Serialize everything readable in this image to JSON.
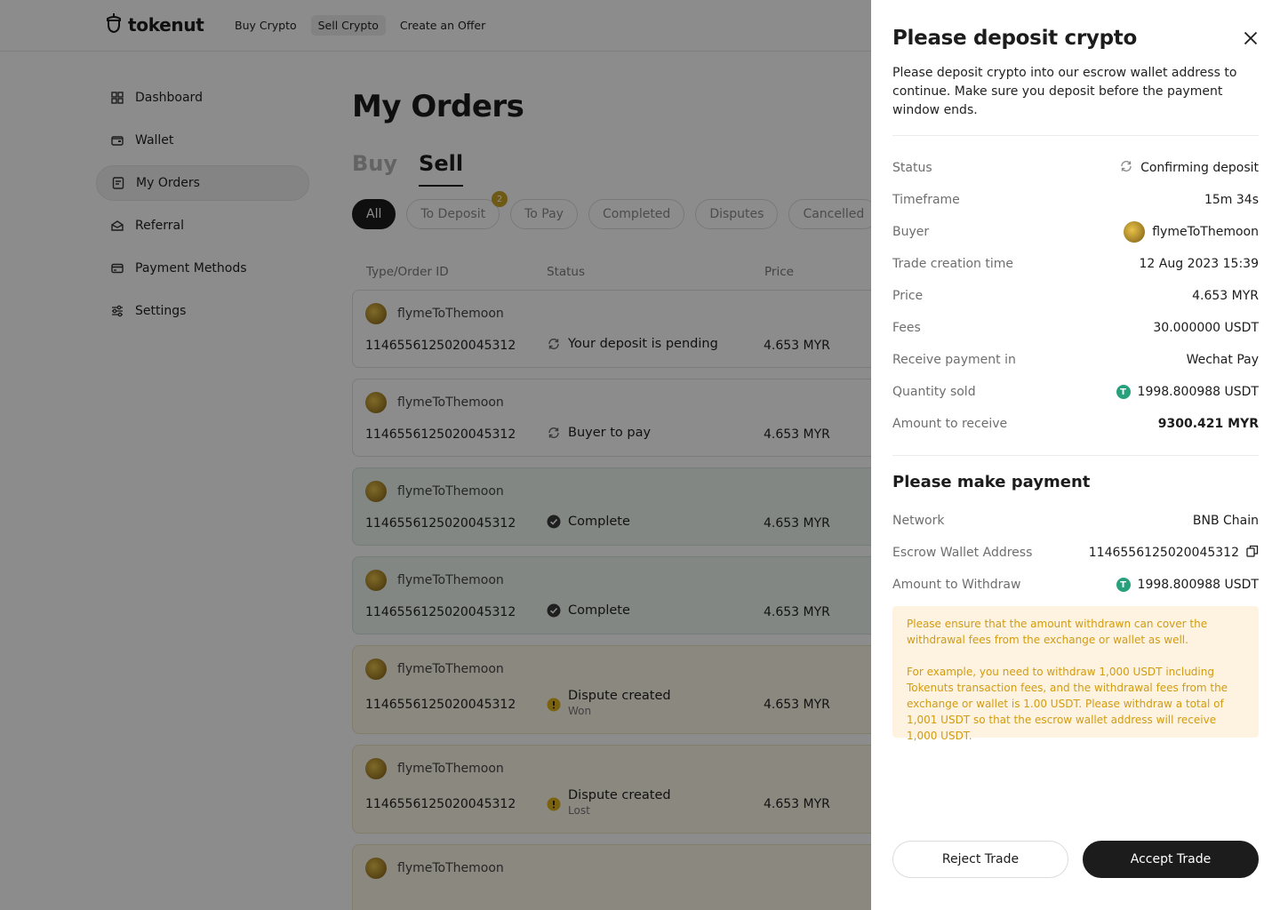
{
  "brand": {
    "name": "tokenut"
  },
  "nav": [
    {
      "label": "Buy Crypto"
    },
    {
      "label": "Sell Crypto"
    },
    {
      "label": "Create an Offer"
    }
  ],
  "sidebar": [
    {
      "label": "Dashboard",
      "icon": "dashboard-icon"
    },
    {
      "label": "Wallet",
      "icon": "wallet-icon"
    },
    {
      "label": "My Orders",
      "icon": "orders-icon"
    },
    {
      "label": "Referral",
      "icon": "referral-icon"
    },
    {
      "label": "Payment Methods",
      "icon": "card-icon"
    },
    {
      "label": "Settings",
      "icon": "sliders-icon"
    }
  ],
  "main": {
    "title": "My Orders",
    "tabs": [
      {
        "label": "Buy"
      },
      {
        "label": "Sell"
      }
    ],
    "filters": [
      {
        "label": "All"
      },
      {
        "label": "To Deposit",
        "badge": "2"
      },
      {
        "label": "To Pay"
      },
      {
        "label": "Completed"
      },
      {
        "label": "Disputes"
      },
      {
        "label": "Cancelled"
      }
    ],
    "columns": [
      "Type/Order ID",
      "Status",
      "Price"
    ],
    "orders": [
      {
        "user": "flymeToThemoon",
        "id": "1146556125020045312",
        "status": "Your deposit is pending",
        "sub": "",
        "price": "4.653 MYR"
      },
      {
        "user": "flymeToThemoon",
        "id": "1146556125020045312",
        "status": "Buyer to pay",
        "sub": "",
        "price": "4.653 MYR"
      },
      {
        "user": "flymeToThemoon",
        "id": "1146556125020045312",
        "status": "Complete",
        "sub": "",
        "price": "4.653 MYR"
      },
      {
        "user": "flymeToThemoon",
        "id": "1146556125020045312",
        "status": "Complete",
        "sub": "",
        "price": "4.653 MYR"
      },
      {
        "user": "flymeToThemoon",
        "id": "1146556125020045312",
        "status": "Dispute created",
        "sub": "Won",
        "price": "4.653 MYR"
      },
      {
        "user": "flymeToThemoon",
        "id": "1146556125020045312",
        "status": "Dispute created",
        "sub": "Lost",
        "price": "4.653 MYR"
      },
      {
        "user": "flymeToThemoon"
      }
    ]
  },
  "drawer": {
    "title": "Please deposit crypto",
    "description": "Please deposit crypto into our escrow wallet address to continue. Make sure you deposit before the payment window ends.",
    "details": [
      {
        "label": "Status",
        "value": "Confirming deposit"
      },
      {
        "label": "Timeframe",
        "value": "15m 34s"
      },
      {
        "label": "Buyer",
        "value": "flymeToThemoon"
      },
      {
        "label": "Trade creation time",
        "value": "12 Aug 2023 15:39"
      },
      {
        "label": "Price",
        "value": "4.653 MYR"
      },
      {
        "label": "Fees",
        "value": "30.000000 USDT"
      },
      {
        "label": "Receive payment in",
        "value": "Wechat Pay"
      },
      {
        "label": "Quantity sold",
        "value": "1998.800988 USDT"
      },
      {
        "label": "Amount to receive",
        "value": "9300.421 MYR"
      }
    ],
    "payment_title": "Please make payment",
    "payment": [
      {
        "label": "Network",
        "value": "BNB Chain"
      },
      {
        "label": "Escrow Wallet Address",
        "value": "1146556125020045312"
      },
      {
        "label": "Amount to Withdraw",
        "value": "1998.800988 USDT"
      }
    ],
    "notice": [
      "Please ensure that the amount withdrawn can cover the withdrawal fees from the exchange or wallet as well.",
      "For example, you need to withdraw 1,000 USDT including Tokenuts transaction fees, and the withdrawal fees from the exchange or wallet is 1.00 USDT. Please withdraw a total of 1,001 USDT so that the escrow wallet address will receive 1,000 USDT."
    ],
    "reject_label": "Reject Trade",
    "accept_label": "Accept Trade"
  },
  "colors": {
    "accent": "#1c1c1c",
    "usdt": "#26a17b",
    "notice_bg": "#fdf3e0",
    "notice_text": "#d29b12",
    "complete_row": "#eef6f1",
    "dispute_row": "#fdf7ea"
  }
}
